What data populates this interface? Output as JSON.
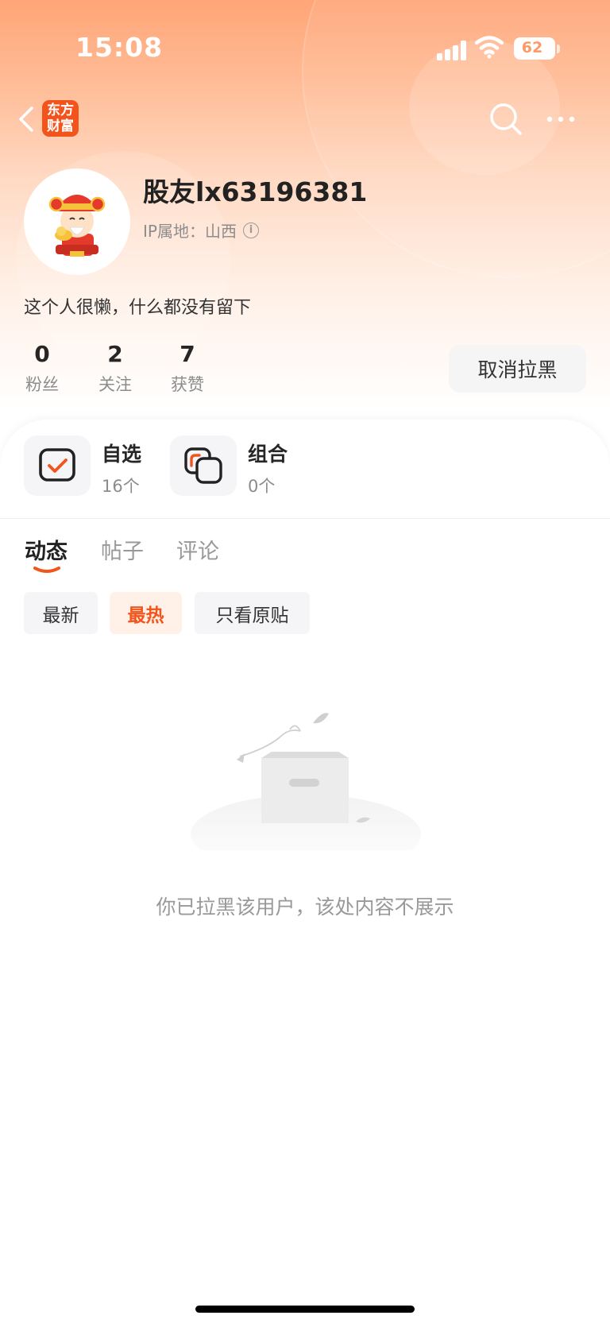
{
  "status_bar": {
    "time": "15:08",
    "battery": "62"
  },
  "header": {
    "app_logo_line1": "东方",
    "app_logo_line2": "财富",
    "back_icon": "chevron-left-icon",
    "search_icon": "search-icon",
    "more_icon": "more-horizontal-icon"
  },
  "profile": {
    "username": "股友lx63196381",
    "ip_location": "IP属地：山西",
    "bio": "这个人很懒，什么都没有留下",
    "stats": [
      {
        "value": "0",
        "label": "粉丝"
      },
      {
        "value": "2",
        "label": "关注"
      },
      {
        "value": "7",
        "label": "获赞"
      }
    ],
    "unblock_label": "取消拉黑"
  },
  "quick_links": [
    {
      "title": "自选",
      "count": "16个",
      "icon": "watchlist-check-icon"
    },
    {
      "title": "组合",
      "count": "0个",
      "icon": "portfolio-icon"
    }
  ],
  "tabs": [
    {
      "label": "动态",
      "active": true
    },
    {
      "label": "帖子",
      "active": false
    },
    {
      "label": "评论",
      "active": false
    }
  ],
  "filters": [
    {
      "label": "最新",
      "active": false
    },
    {
      "label": "最热",
      "active": true
    },
    {
      "label": "只看原贴",
      "active": false
    }
  ],
  "empty_state": {
    "message": "你已拉黑该用户，该处内容不展示",
    "icon": "empty-box-icon"
  },
  "colors": {
    "accent": "#f2541c",
    "hero_top": "#ffa577"
  }
}
